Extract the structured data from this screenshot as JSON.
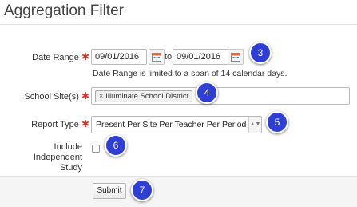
{
  "title": "Aggregation Filter",
  "date_range": {
    "label": "Date Range",
    "start": "09/01/2016",
    "to": "to",
    "end": "09/01/2016",
    "help": "Date Range is limited to a span of 14 calendar days."
  },
  "school_sites": {
    "label": "School Site(s)",
    "chip_remove": "×",
    "chip_label": "Illuminate School District"
  },
  "report_type": {
    "label": "Report Type",
    "selected": "Present Per Site Per Teacher Per Period",
    "arrow": "▲▼"
  },
  "independent_study": {
    "label_line1": "Include Independent",
    "label_line2": "Study",
    "checked": false
  },
  "required_mark": "✱",
  "submit_label": "Submit",
  "callouts": [
    "3",
    "4",
    "5",
    "6",
    "7"
  ],
  "colors": {
    "callout": "#2f3fd6",
    "required": "#d9342a"
  }
}
